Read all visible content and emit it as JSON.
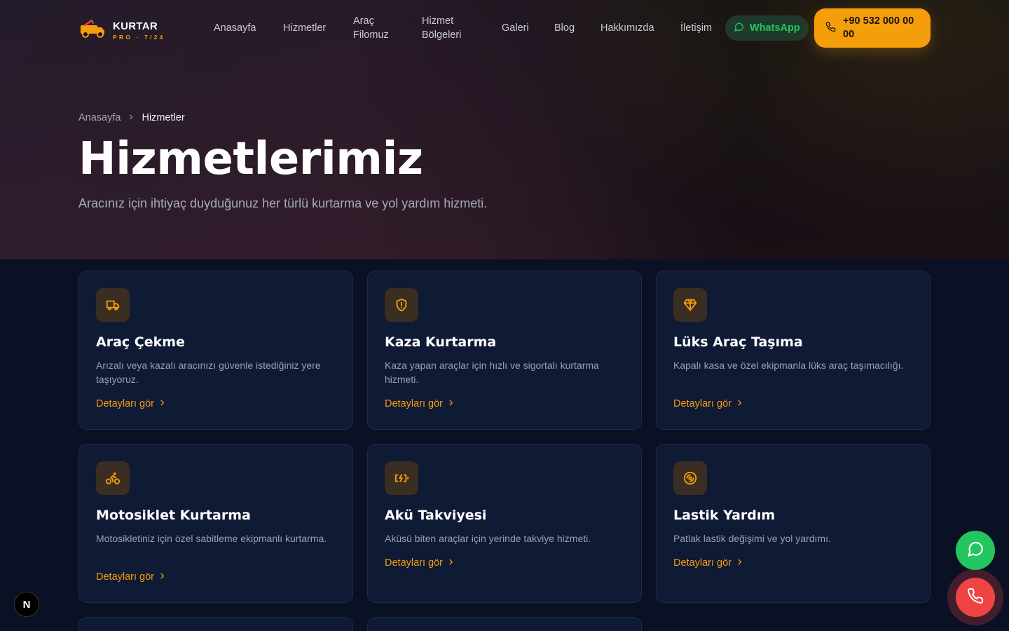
{
  "brand": {
    "name": "KURTAR",
    "tagline": "PRO · 7/24",
    "accent": "#f59e0b"
  },
  "nav": {
    "links": [
      "Anasayfa",
      "Hizmetler",
      "Araç Filomuz",
      "Hizmet Bölgeleri",
      "Galeri",
      "Blog",
      "Hakkımızda",
      "İletişim"
    ],
    "whatsapp_label": "WhatsApp",
    "phone_label": "+90 532 000 00 00"
  },
  "breadcrumb": {
    "home": "Anasayfa",
    "current": "Hizmetler"
  },
  "hero": {
    "title": "Hizmetlerimiz",
    "subtitle": "Aracınız için ihtiyaç duyduğunuz her türlü kurtarma ve yol yardım hizmeti."
  },
  "services": [
    {
      "icon": "truck-icon",
      "title": "Araç Çekme",
      "desc": "Arızalı veya kazalı aracınızı güvenle istediğiniz yere taşıyoruz.",
      "link": "Detayları gör"
    },
    {
      "icon": "shield-alert-icon",
      "title": "Kaza Kurtarma",
      "desc": "Kaza yapan araçlar için hızlı ve sigortalı kurtarma hizmeti.",
      "link": "Detayları gör"
    },
    {
      "icon": "gem-icon",
      "title": "Lüks Araç Taşıma",
      "desc": "Kapalı kasa ve özel ekipmanla lüks araç taşımacılığı.",
      "link": "Detayları gör"
    },
    {
      "icon": "bike-icon",
      "title": "Motosiklet Kurtarma",
      "desc": "Motosikletiniz için özel sabitleme ekipmanlı kurtarma.",
      "link": "Detayları gör"
    },
    {
      "icon": "battery-charging-icon",
      "title": "Akü Takviyesi",
      "desc": "Aküsü biten araçlar için yerinde takviye hizmeti.",
      "link": "Detayları gör"
    },
    {
      "icon": "tire-icon",
      "title": "Lastik Yardım",
      "desc": "Patlak lastik değişimi ve yol yardımı.",
      "link": "Detayları gör"
    }
  ],
  "floating": {
    "next_badge": "N"
  }
}
